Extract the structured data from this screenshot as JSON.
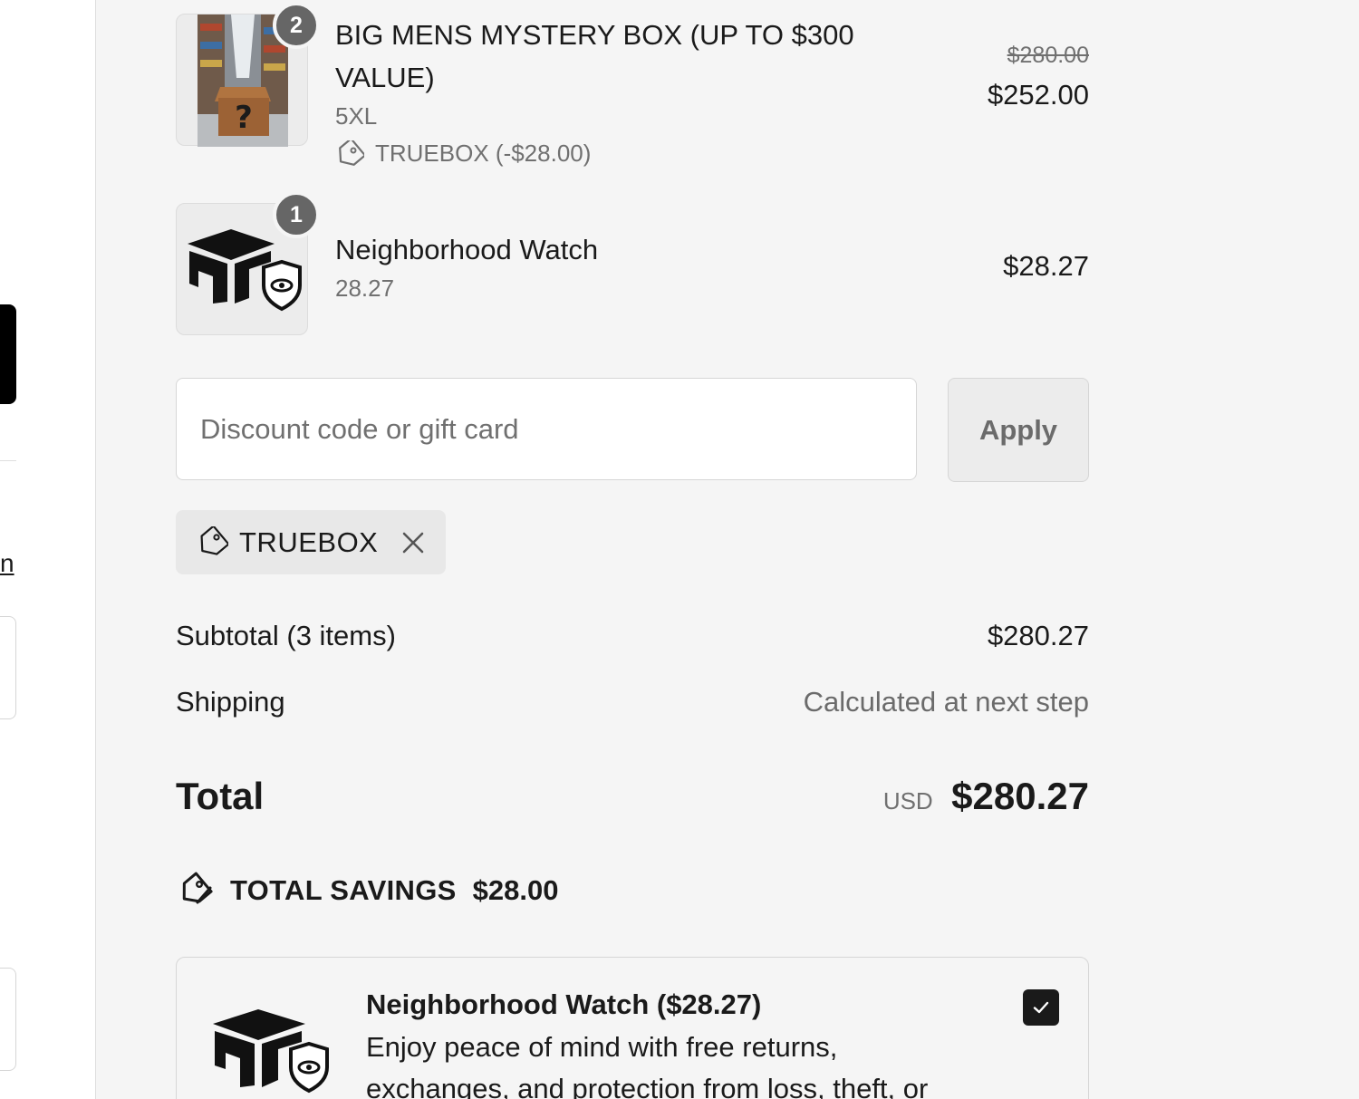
{
  "left_column": {
    "link_fragment": "n"
  },
  "line_items": [
    {
      "quantity": "2",
      "name": "BIG MENS MYSTERY BOX (UP TO $300 VALUE)",
      "variant": "5XL",
      "discount_label": "TRUEBOX (-$28.00)",
      "compare_price": "$280.00",
      "price": "$252.00",
      "image_icon": "mystery-box-image"
    },
    {
      "quantity": "1",
      "name": "Neighborhood Watch",
      "variant": "28.27",
      "price": "$28.27",
      "image_icon": "neighborhood-watch-logo"
    }
  ],
  "discount": {
    "placeholder": "Discount code or gift card",
    "value": "",
    "apply_label": "Apply",
    "applied_code": "TRUEBOX"
  },
  "totals": {
    "subtotal_label": "Subtotal (3 items)",
    "subtotal_value": "$280.27",
    "shipping_label": "Shipping",
    "shipping_value": "Calculated at next step",
    "total_label": "Total",
    "currency": "USD",
    "total_value": "$280.27",
    "savings_label": "TOTAL SAVINGS",
    "savings_value": "$28.00"
  },
  "protection": {
    "title": "Neighborhood Watch ($28.27)",
    "description": "Enjoy peace of mind with free returns, exchanges, and protection from loss, theft, or",
    "checked": true
  },
  "colors": {
    "summary_bg": "#f5f5f5",
    "badge": "#666666",
    "text": "#1a1a1a",
    "muted": "#707070",
    "checkbox": "#1a1a1a"
  }
}
